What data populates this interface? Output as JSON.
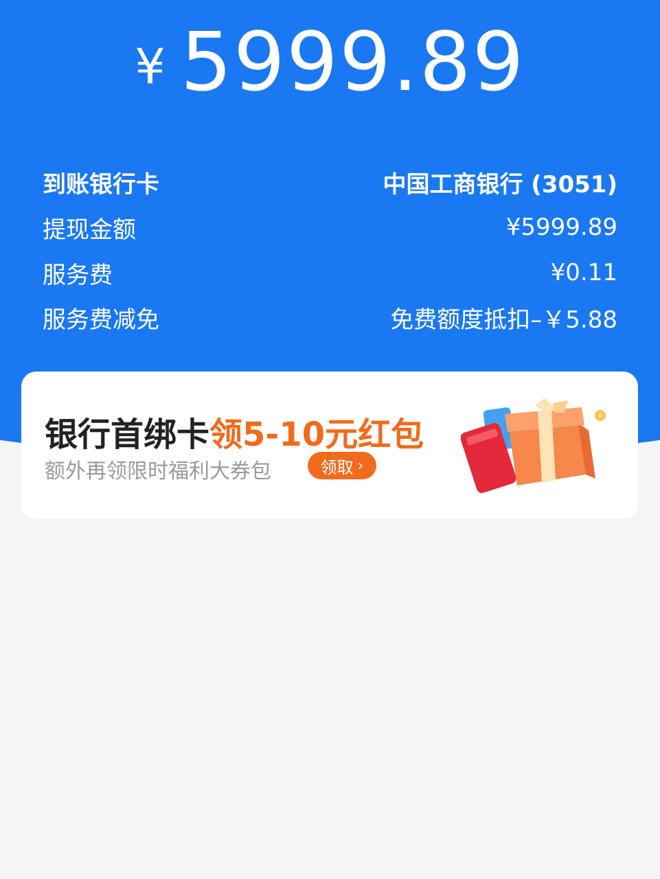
{
  "header": {
    "currency_symbol": "¥",
    "amount": "5999.89"
  },
  "details": [
    {
      "label": "到账银行卡",
      "value": "中国工商银行 (3051)"
    },
    {
      "label": "提现金额",
      "value": "¥5999.89"
    },
    {
      "label": "服务费",
      "value": "¥0.11"
    },
    {
      "label": "服务费减免",
      "value": "免费额度抵扣–￥5.88"
    }
  ],
  "promo": {
    "title_prefix": "银行首绑卡",
    "title_highlight": "领5-10元红包",
    "subtitle": "额外再领限时福利大券包",
    "button_label": "领取",
    "button_icon": "chevron-right-icon"
  },
  "colors": {
    "primary_blue": "#1a78f2",
    "accent_orange": "#f26a1b",
    "background": "#f5f5f5"
  }
}
